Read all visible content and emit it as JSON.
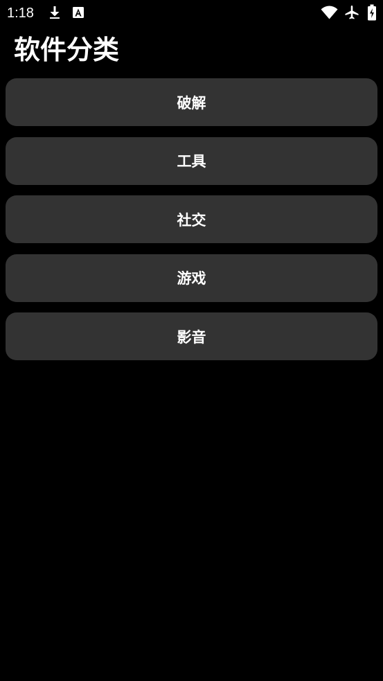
{
  "status_bar": {
    "time": "1:18",
    "left_icons": [
      "download-icon",
      "font-a-icon"
    ],
    "right_icons": [
      "wifi-icon",
      "airplane-mode-icon",
      "battery-icon"
    ]
  },
  "page": {
    "title": "软件分类"
  },
  "categories": [
    {
      "label": "破解"
    },
    {
      "label": "工具"
    },
    {
      "label": "社交"
    },
    {
      "label": "游戏"
    },
    {
      "label": "影音"
    }
  ],
  "colors": {
    "background": "#000000",
    "button_background": "#333333",
    "text": "#ffffff"
  }
}
